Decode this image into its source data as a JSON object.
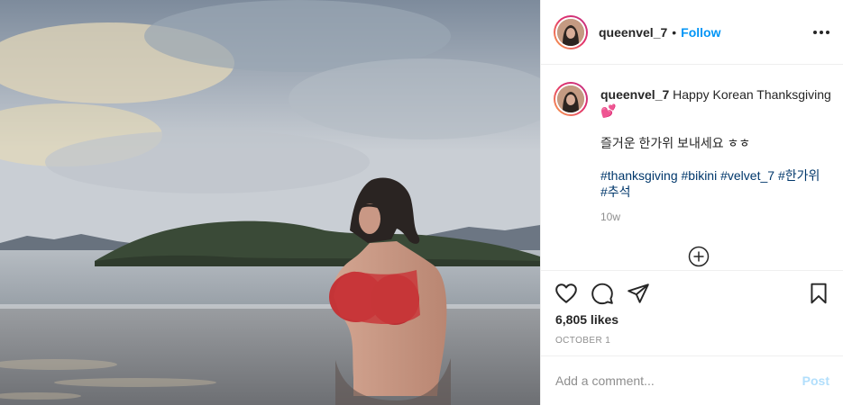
{
  "post": {
    "username": "queenvel_7",
    "follow_separator": "•",
    "follow_label": "Follow",
    "more_icon": "more-horizontal-icon"
  },
  "caption": {
    "username": "queenvel_7",
    "text": "Happy Korean Thanksgiving",
    "emoji": "💕",
    "korean_line": "즐거운 한가위 보내세요 ㅎㅎ",
    "hashtags": [
      "#thanksgiving",
      "#bikini",
      "#velvet_7",
      "#한가위",
      "#추석"
    ],
    "time_ago": "10w",
    "load_more_icon": "plus-circle-icon"
  },
  "actions": {
    "icons": [
      "heart-icon",
      "comment-icon",
      "share-icon",
      "bookmark-icon"
    ],
    "likes": "6,805 likes",
    "date": "OCTOBER 1"
  },
  "comment": {
    "placeholder": "Add a comment...",
    "post_label": "Post"
  },
  "colors": {
    "link": "#0095f6",
    "hashtag": "#00376b",
    "secondary": "#8e8e8e",
    "post_disabled": "#b2dffc",
    "border": "#efefef"
  }
}
